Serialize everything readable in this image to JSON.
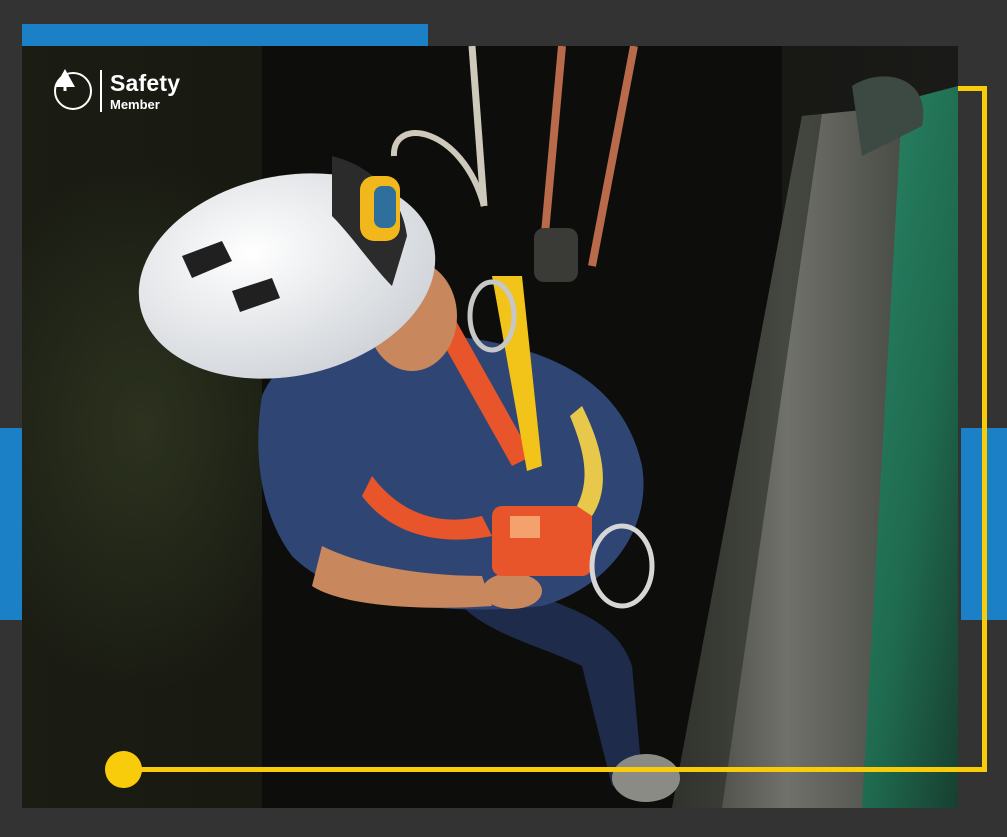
{
  "logo": {
    "title": "Safety",
    "subtitle": "Member",
    "icon": "tree-icon"
  },
  "colors": {
    "background": "#333333",
    "accent_blue": "#1b80c6",
    "accent_yellow": "#f9cc0b",
    "logo_text": "#ffffff"
  }
}
